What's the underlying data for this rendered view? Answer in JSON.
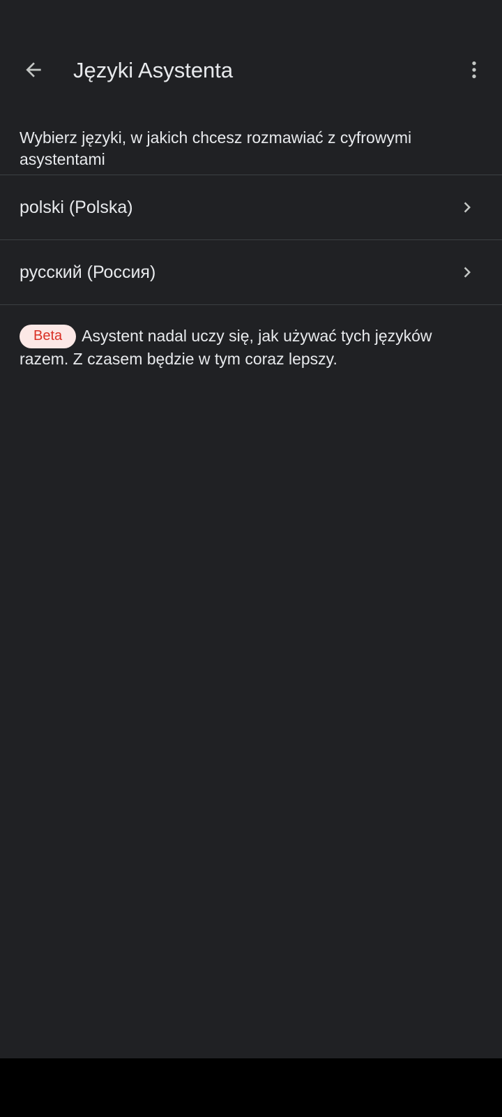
{
  "header": {
    "title": "Języki Asystenta",
    "back_icon": "arrow-left-icon",
    "menu_icon": "more-vertical-icon"
  },
  "description": "Wybierz języki, w jakich chcesz rozmawiać z cyfrowymi asystentami",
  "languages": [
    {
      "label": "polski (Polska)"
    },
    {
      "label": "русский (Россия)"
    }
  ],
  "beta": {
    "badge": "Beta",
    "text": "Asystent nadal uczy się, jak używać tych języków razem. Z czasem będzie w tym coraz lepszy."
  },
  "colors": {
    "background": "#202124",
    "text": "#e8eaed",
    "divider": "#3c4043",
    "beta_badge_bg": "#fce8e6",
    "beta_badge_text": "#d93025"
  }
}
